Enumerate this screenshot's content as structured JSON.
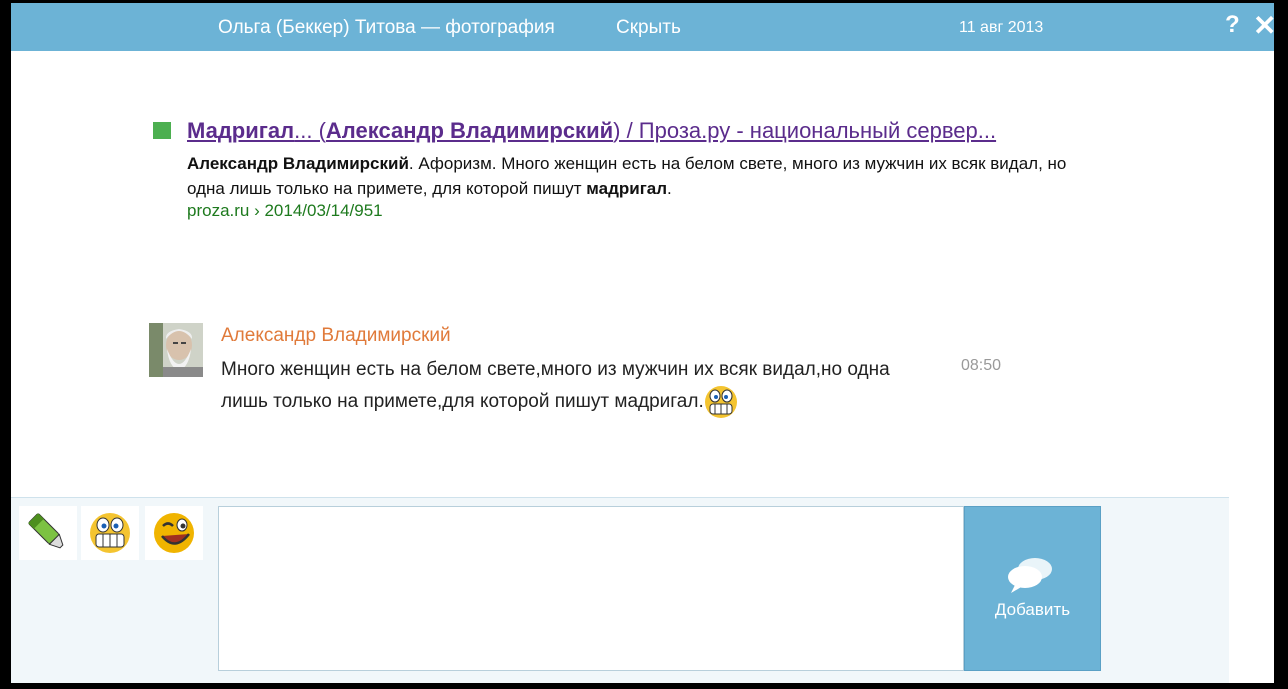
{
  "topbar": {
    "title": "Ольга (Беккер) Титова — фотография",
    "hide_label": "Скрыть",
    "date": "11 авг 2013",
    "help_icon": "?",
    "close_icon": "✕"
  },
  "search_result": {
    "link_part1": "Мадригал",
    "link_part2": "... (",
    "link_part3": "Александр Владимирский",
    "link_part4": ") / Проза.ру - национальный сервер...",
    "snippet_bold1": "Александр Владимирский",
    "snippet_text1": ". Афоризм. Много женщин есть на белом свете, много из мужчин их всяк видал, но одна лишь только на примете, для которой пишут ",
    "snippet_bold2": "мадригал",
    "snippet_text2": ".",
    "url": "proza.ru › 2014/03/14/951",
    "bullet_color": "#4caf50"
  },
  "comment": {
    "author": "Александр Владимирский",
    "text": "Много женщин есть на белом свете,много из мужчин их всяк видал,но одна лишь только на примете,для которой пишут мадригал.",
    "time": "08:50",
    "author_color": "#e07a3a"
  },
  "compose": {
    "tools": [
      "highlighter-icon",
      "grin-smiley-icon",
      "wink-smiley-icon"
    ],
    "add_label": "Добавить",
    "accent": "#6cb3d6"
  }
}
